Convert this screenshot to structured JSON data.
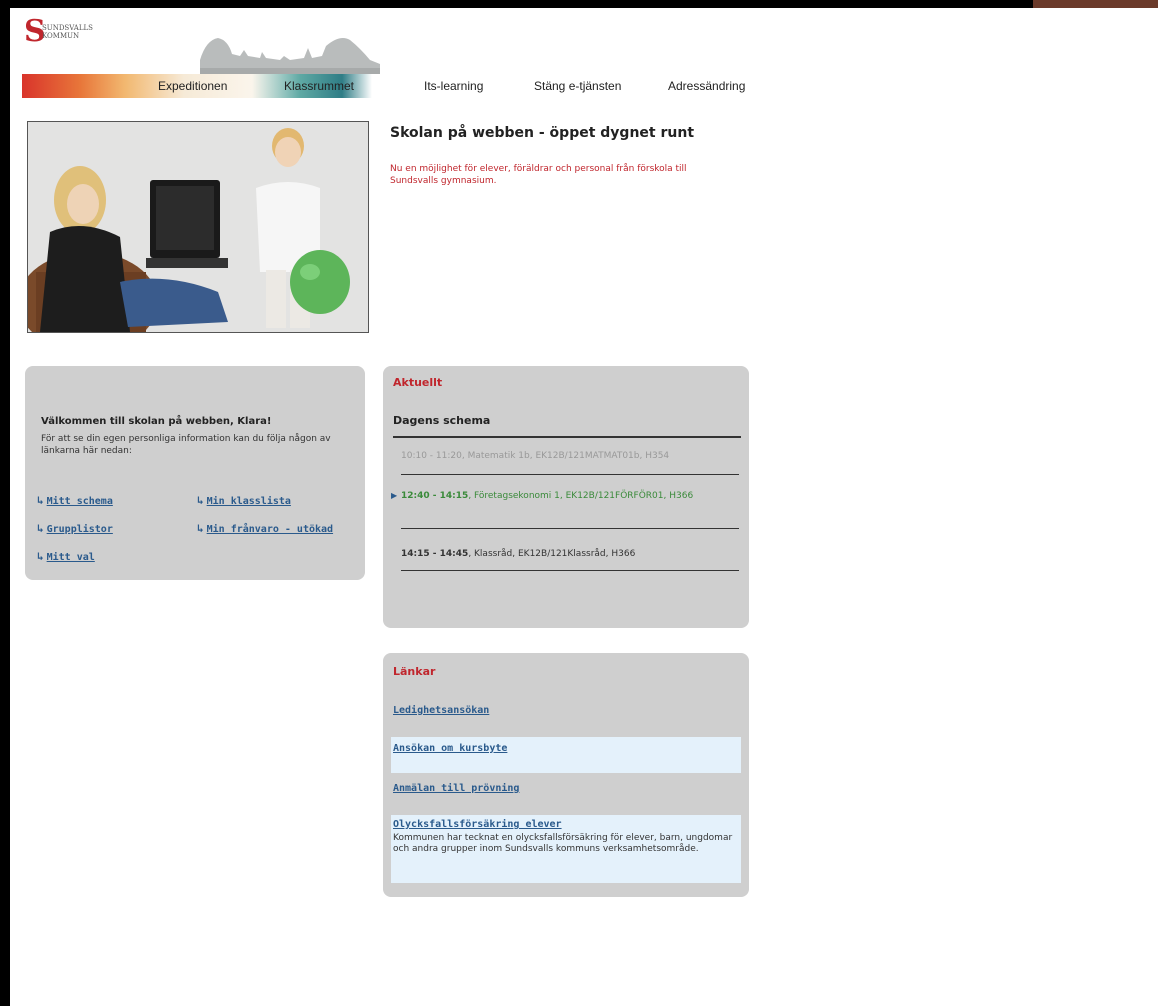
{
  "header": {
    "logo_lines": [
      "SUNDSVALLS",
      "KOMMUN"
    ],
    "nav": [
      "Expeditionen",
      "Klassrummet",
      "Its-learning",
      "Stäng e-tjänsten",
      "Adressändring"
    ]
  },
  "hero": {
    "title": "Skolan på webben - öppet dygnet runt",
    "text": "Nu en möjlighet för elever, föräldrar och personal från förskola till Sundsvalls gymnasium."
  },
  "welcome": {
    "title": "Välkommen till skolan på webben, Klara!",
    "text": "För att se din egen personliga information kan du följa någon av länkarna här nedan:",
    "links": [
      "Mitt schema",
      "Min klasslista",
      "Grupplistor",
      "Min frånvaro - utökad",
      "Mitt val"
    ]
  },
  "aktuellt": {
    "title": "Aktuellt",
    "subtitle": "Dagens schema",
    "items": [
      {
        "time": "10:10 - 11:20",
        "rest": ", Matematik 1b, EK12B/121MATMAT01b, H354"
      },
      {
        "time": "12:40 - 14:15",
        "rest": ", Företagsekonomi 1, EK12B/121FÖRFÖR01, H366"
      },
      {
        "time": "14:15 - 14:45",
        "rest": ", Klassråd, EK12B/121Klassråd, H366"
      }
    ]
  },
  "lankar": {
    "title": "Länkar",
    "links": [
      {
        "label": "Ledighetsansökan",
        "desc": ""
      },
      {
        "label": "Ansökan om kursbyte",
        "desc": ""
      },
      {
        "label": "Anmälan till prövning",
        "desc": ""
      },
      {
        "label": "Olycksfallsförsäkring elever",
        "desc": "Kommunen har tecknat en olycksfallsförsäkring för elever, barn, ungdomar och andra grupper inom Sundsvalls kommuns verksamhetsområde."
      }
    ]
  },
  "colors": {
    "brand_red": "#c0262d",
    "link_blue": "#2a5a8c",
    "panel_gray": "#cfcfcf",
    "highlight_blue": "#e4f1fb",
    "current_green": "#3a8a3a",
    "past_gray": "#999999"
  }
}
